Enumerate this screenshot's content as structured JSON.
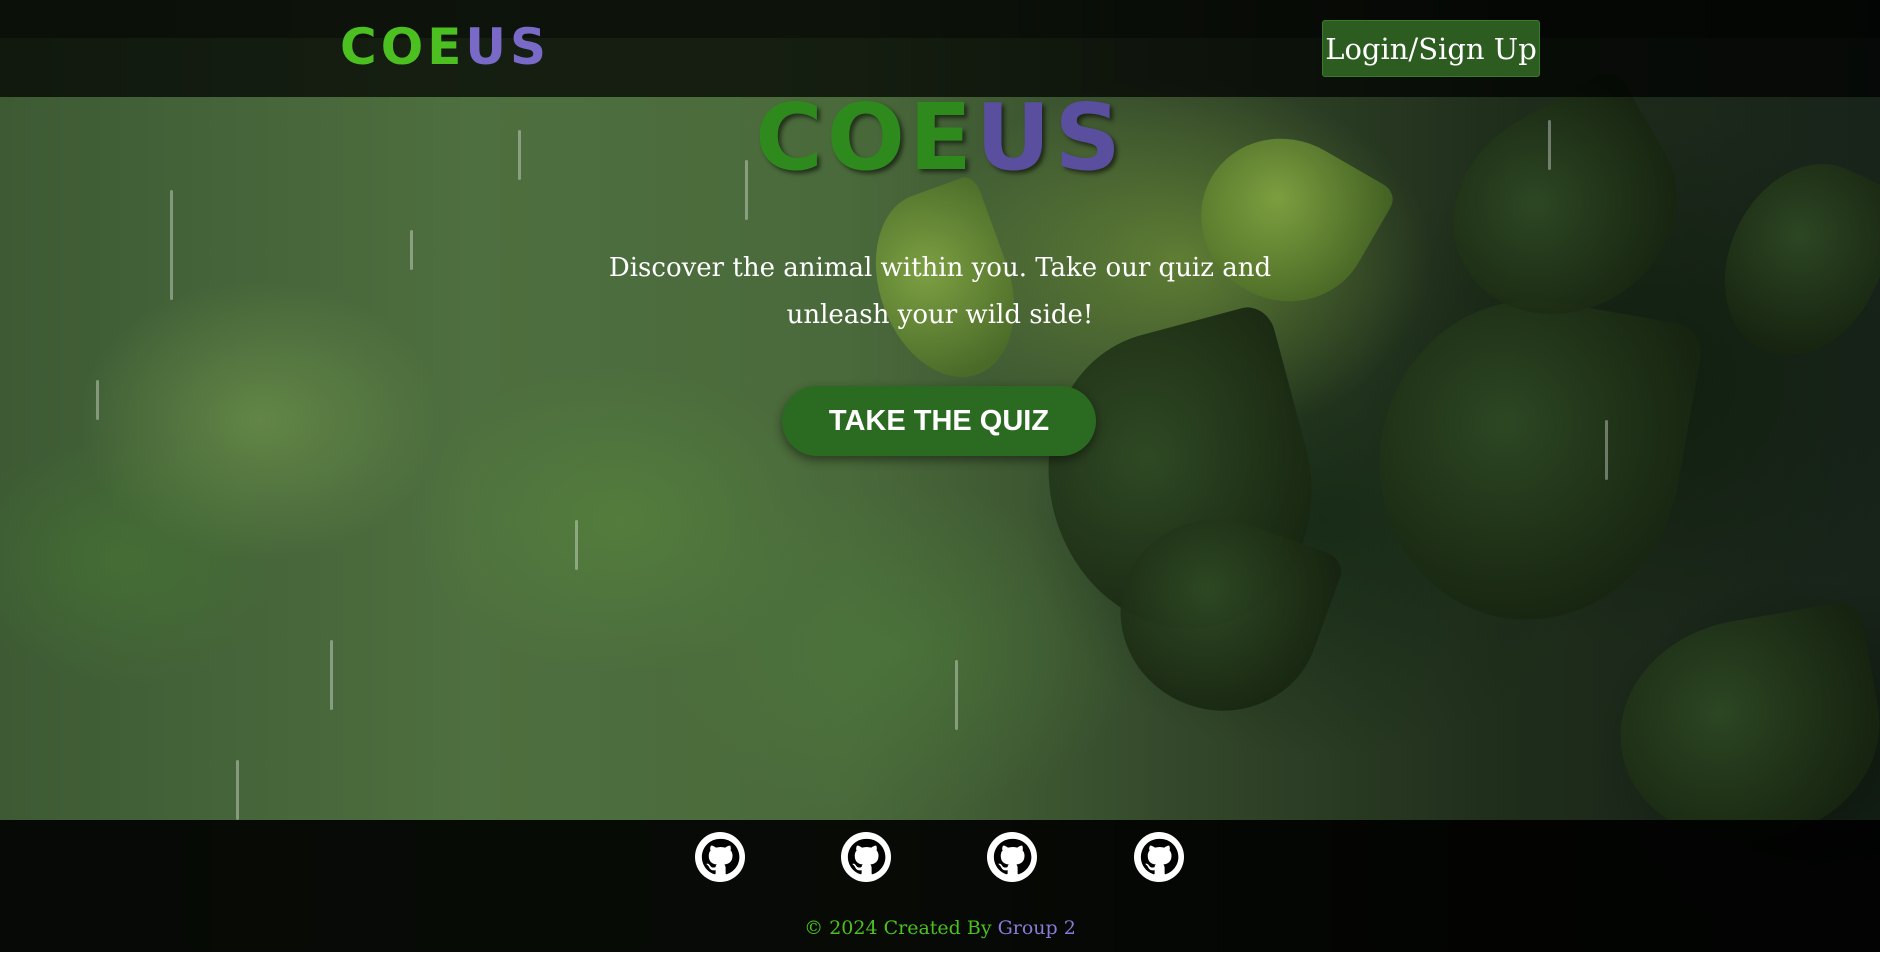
{
  "header": {
    "brand": {
      "part1": "COE",
      "part2": "US"
    },
    "login_label": "Login/Sign Up"
  },
  "hero": {
    "title": {
      "part1": "COE",
      "part2": "US"
    },
    "tagline": "Discover the animal within you. Take our quiz and unleash your wild side!",
    "cta_label": "TAKE THE QUIZ"
  },
  "footer": {
    "links": [
      {
        "icon": "github-icon"
      },
      {
        "icon": "github-icon"
      },
      {
        "icon": "github-icon"
      },
      {
        "icon": "github-icon"
      }
    ],
    "copyright": {
      "part1": "© 2024 Created By ",
      "part2": "Group 2"
    }
  },
  "colors": {
    "brand_green": "#4cc021",
    "brand_purple": "#7a6ac8",
    "button_green": "#2b6b21",
    "login_green": "#2c5c20"
  }
}
